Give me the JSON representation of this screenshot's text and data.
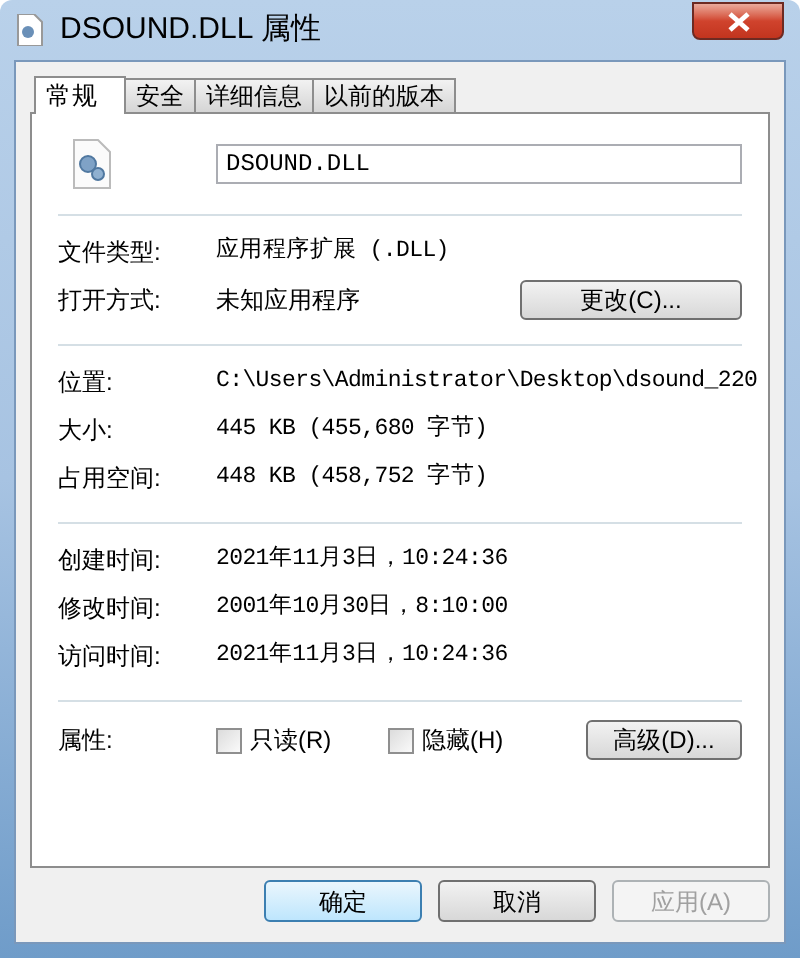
{
  "window": {
    "title": "DSOUND.DLL 属性"
  },
  "tabs": [
    {
      "label": "常规",
      "selected": true
    },
    {
      "label": "安全",
      "selected": false
    },
    {
      "label": "详细信息",
      "selected": false
    },
    {
      "label": "以前的版本",
      "selected": false
    }
  ],
  "file_name": {
    "value": "DSOUND.DLL"
  },
  "sections": [
    {
      "rows": [
        {
          "kind": "text",
          "label": "文件类型:",
          "value": "应用程序扩展 (.DLL)"
        },
        {
          "kind": "text_button",
          "label": "打开方式:",
          "value": "未知应用程序",
          "button": "更改(C)..."
        }
      ]
    },
    {
      "rows": [
        {
          "kind": "text",
          "label": "位置:",
          "value": "C:\\Users\\Administrator\\Desktop\\dsound_220"
        },
        {
          "kind": "text",
          "label": "大小:",
          "value": "445 KB (455,680 字节)"
        },
        {
          "kind": "text",
          "label": "占用空间:",
          "value": "448 KB (458,752 字节)"
        }
      ]
    },
    {
      "rows": [
        {
          "kind": "text",
          "label": "创建时间:",
          "value": "2021年11月3日，10:24:36"
        },
        {
          "kind": "text",
          "label": "修改时间:",
          "value": "2001年10月30日，8:10:00"
        },
        {
          "kind": "text",
          "label": "访问时间:",
          "value": "2021年11月3日，10:24:36"
        }
      ]
    },
    {
      "rows": [
        {
          "kind": "checkboxes",
          "label": "属性:",
          "checkboxes": [
            {
              "label": "只读(R)",
              "checked": false
            },
            {
              "label": "隐藏(H)",
              "checked": false
            }
          ],
          "button": "高级(D)..."
        }
      ]
    }
  ],
  "buttons": [
    {
      "label": "确定",
      "default": true,
      "disabled": false
    },
    {
      "label": "取消",
      "default": false,
      "disabled": false
    },
    {
      "label": "应用(A)",
      "default": false,
      "disabled": true
    }
  ]
}
